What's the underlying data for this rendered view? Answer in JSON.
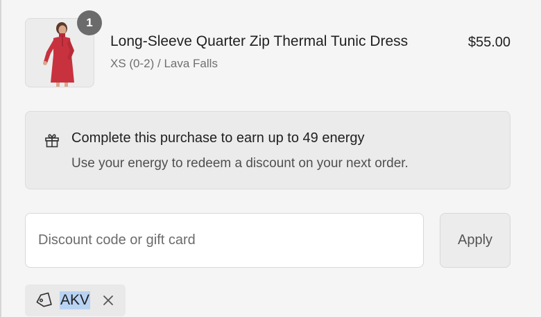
{
  "cart": {
    "item": {
      "quantity": "1",
      "name": "Long-Sleeve Quarter Zip Thermal Tunic Dress",
      "variant": "XS (0-2) / Lava Falls",
      "price": "$55.00",
      "image_icon": "product-photo-red-dress"
    }
  },
  "energy": {
    "icon": "gift-icon",
    "title": "Complete this purchase to earn up to 49 energy",
    "subtitle": "Use your energy to redeem a discount on your next order."
  },
  "discount": {
    "placeholder": "Discount code or gift card",
    "value": "",
    "apply_label": "Apply",
    "applied_code": "AKV",
    "applied_code_icon": "tag-icon",
    "remove_icon": "close-icon"
  },
  "colors": {
    "background": "#f5f5f5",
    "badge": "#6b6b6b",
    "dress": "#c8323f",
    "selection_highlight": "#b9d3f3"
  }
}
